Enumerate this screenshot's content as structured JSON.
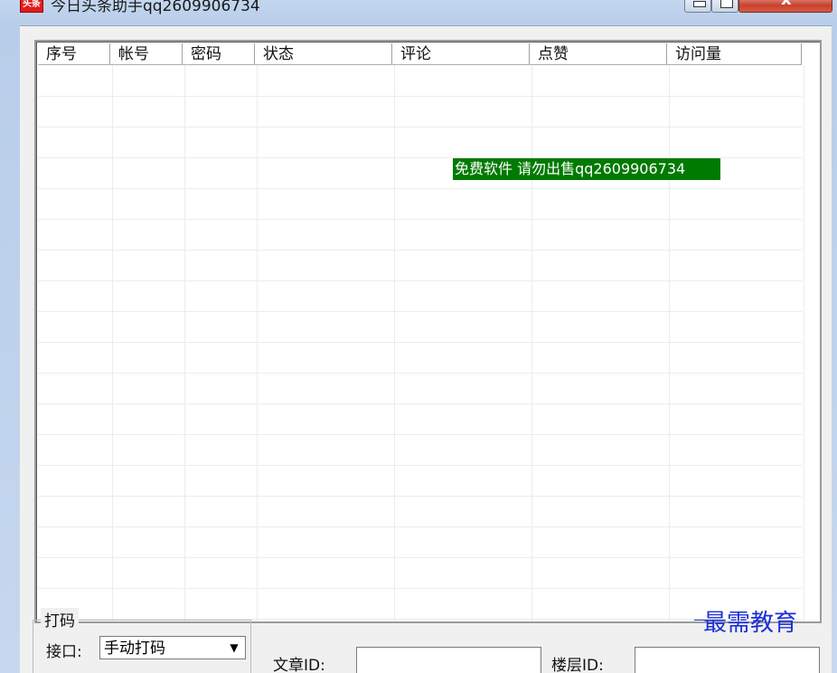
{
  "window": {
    "title": "今日头条助手qq2609906734",
    "icon_text": "头条"
  },
  "listview": {
    "columns": [
      "序号",
      "帐号",
      "密码",
      "状态",
      "评论",
      "点赞",
      "访问量"
    ],
    "rows": []
  },
  "overlay_text": "免费软件 请勿出售qq2609906734",
  "captcha_group": {
    "title": "打码",
    "interface_label": "接口:",
    "interface_value": "手动打码",
    "arrow": "▼"
  },
  "article_id_label": "文章ID:",
  "floor_id_label": "楼层ID:",
  "watermark": "最需教育"
}
